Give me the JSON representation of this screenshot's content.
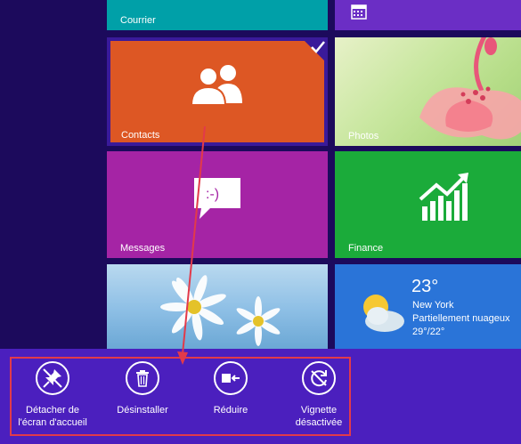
{
  "tiles": {
    "courrier": "Courrier",
    "contacts": "Contacts",
    "photos": "Photos",
    "messages": "Messages",
    "finance": "Finance"
  },
  "weather": {
    "temp": "23°",
    "city": "New York",
    "condition": "Partiellement nuageux",
    "range": "29°/22°"
  },
  "app_commands": [
    {
      "label": "Détacher de\nl'écran d'accueil",
      "icon": "unpin-icon"
    },
    {
      "label": "Désinstaller",
      "icon": "trash-icon"
    },
    {
      "label": "Réduire",
      "icon": "resize-smaller-icon"
    },
    {
      "label": "Vignette\ndésactivée",
      "icon": "live-tile-off-icon"
    }
  ],
  "colors": {
    "background": "#1c0a5c",
    "app_bar": "#4b1fbe",
    "contacts_tile": "#dd5724",
    "annotation": "#e23a4a"
  }
}
